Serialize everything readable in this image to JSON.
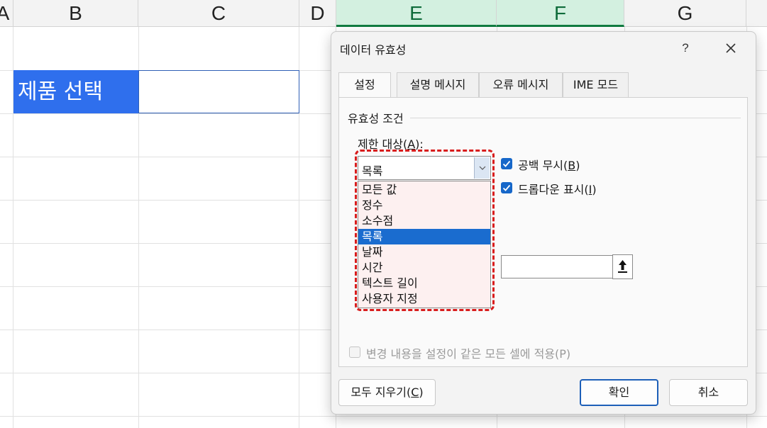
{
  "sheet": {
    "column_headers": [
      "A",
      "B",
      "C",
      "D",
      "E",
      "F",
      "G"
    ],
    "selected_columns": [
      "E",
      "F"
    ],
    "cell_b_label": "제품 선택",
    "label_fill_color": "#2f6fed",
    "selected_header_color": "#107c41"
  },
  "dialog": {
    "title": "데이터 유효성",
    "help_label": "?",
    "close_icon": "close-icon",
    "tabs": [
      {
        "label": "설정",
        "active": true
      },
      {
        "label": "설명 메시지",
        "active": false
      },
      {
        "label": "오류 메시지",
        "active": false
      },
      {
        "label": "IME 모드",
        "active": false
      }
    ],
    "settings": {
      "group_title": "유효성 조건",
      "allow_label_pre": "제한 대상(",
      "allow_label_key": "A",
      "allow_label_post": "):",
      "allow_value": "목록",
      "allow_options": [
        "모든 값",
        "정수",
        "소수점",
        "목록",
        "날짜",
        "시간",
        "텍스트 길이",
        "사용자 지정"
      ],
      "selected_option": "목록",
      "ignore_blank": {
        "checked": true,
        "label_pre": "공백 무시(",
        "label_key": "B",
        "label_post": ")"
      },
      "in_cell_dropdown": {
        "checked": true,
        "label_pre": "드롭다운 표시(",
        "label_key": "I",
        "label_post": ")"
      },
      "source_value": "",
      "range_picker_icon": "range-select-icon",
      "apply_all": {
        "checked": false,
        "enabled": false,
        "label": "변경 내용을 설정이 같은 모든 셀에 적용(P)"
      }
    },
    "footer": {
      "clear_pre": "모두 지우기(",
      "clear_key": "C",
      "clear_post": ")",
      "ok_label": "확인",
      "cancel_label": "취소"
    },
    "highlight_color": "#d81c1c",
    "checkbox_color": "#1667c9"
  }
}
